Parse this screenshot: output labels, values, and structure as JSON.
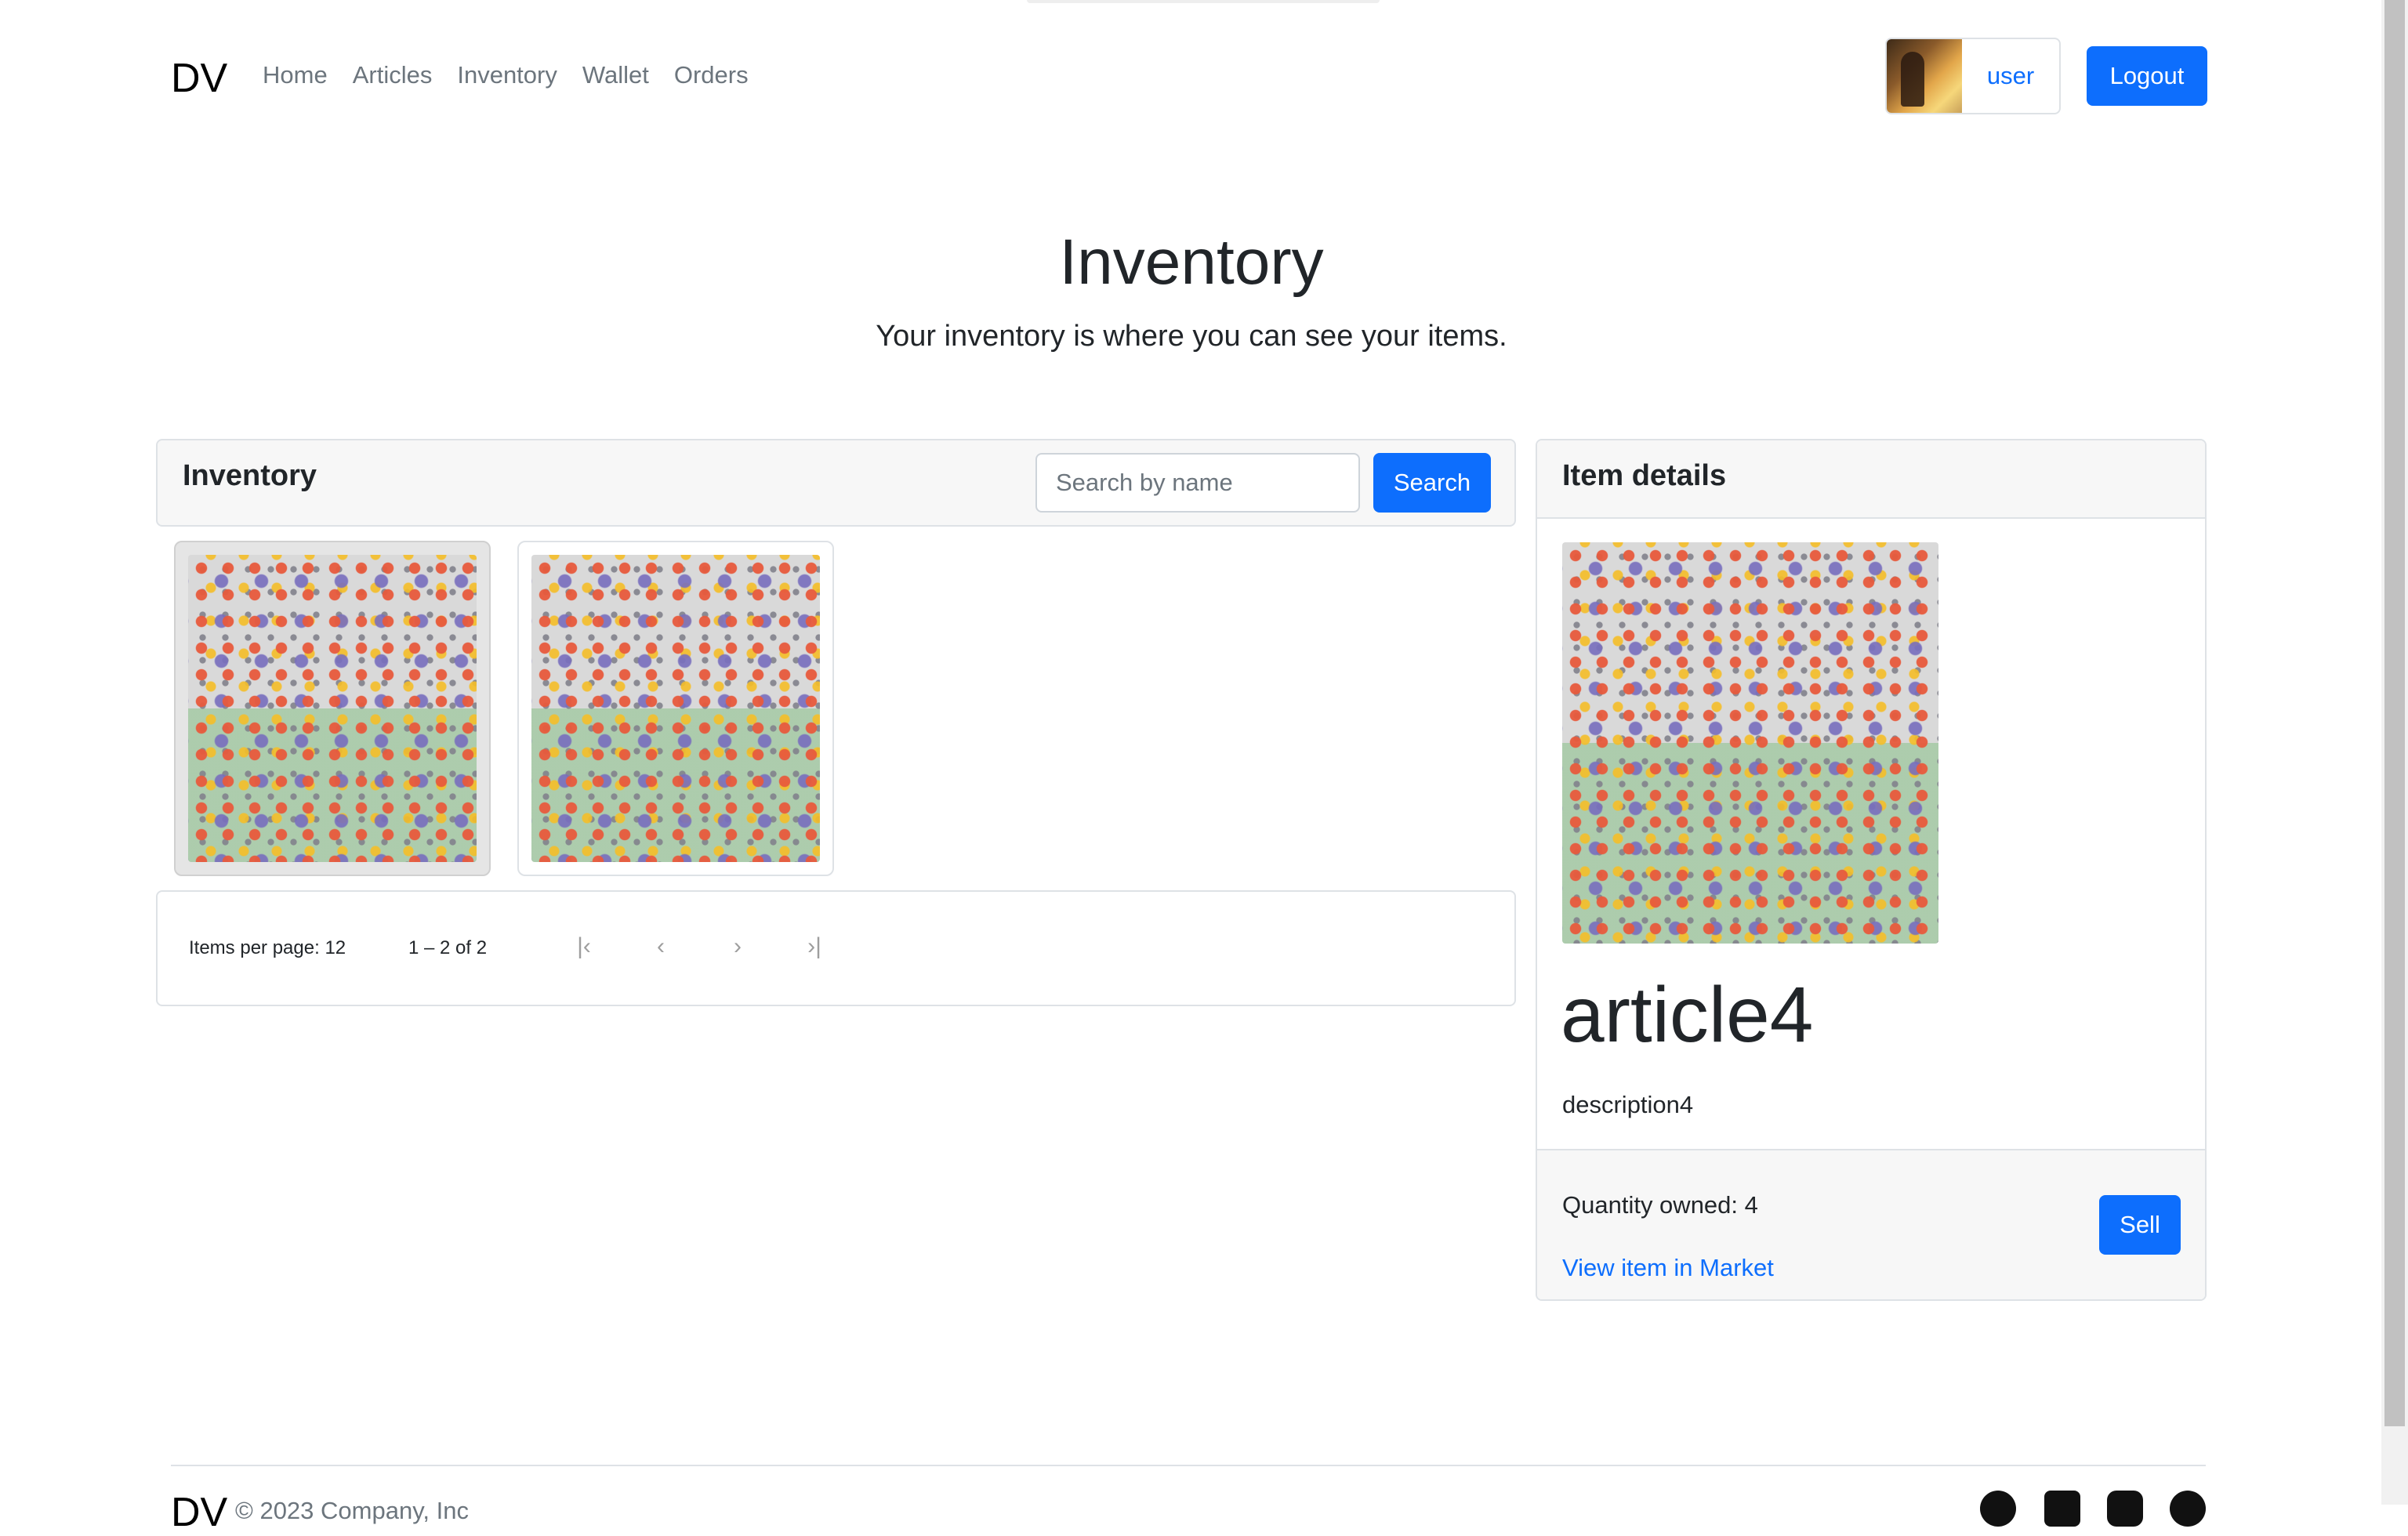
{
  "nav": {
    "brand": "DV",
    "links": [
      "Home",
      "Articles",
      "Inventory",
      "Wallet",
      "Orders"
    ],
    "user": "user",
    "logout": "Logout"
  },
  "hero": {
    "title": "Inventory",
    "subtitle": "Your inventory is where you can see your items."
  },
  "inventory": {
    "title": "Inventory",
    "search_placeholder": "Search by name",
    "search_button": "Search",
    "items": [
      {
        "name": "article4",
        "selected": true
      },
      {
        "name": "",
        "selected": false
      }
    ],
    "pager": {
      "items_per_page_label": "Items per page:",
      "items_per_page": "12",
      "range": "1 – 2 of 2"
    }
  },
  "details": {
    "title": "Item details",
    "name": "article4",
    "description": "description4",
    "quantity_label": "Quantity owned: 4",
    "market_link": "View item in Market",
    "sell": "Sell"
  },
  "footer": {
    "brand": "DV",
    "copyright": "© 2023 Company, Inc"
  },
  "icons": [
    "github-icon",
    "twitter-icon",
    "instagram-icon",
    "facebook-icon"
  ],
  "colors": {
    "primary": "#0d6efd",
    "muted": "#6c757d"
  }
}
